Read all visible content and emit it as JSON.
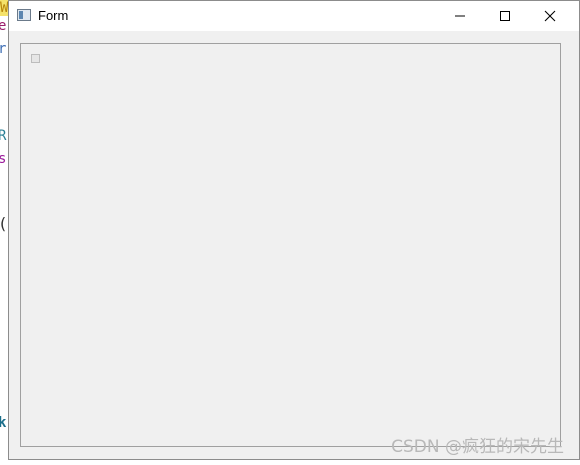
{
  "window": {
    "title": "Form",
    "controls": {
      "minimize": "minimize",
      "maximize": "maximize",
      "close": "close"
    }
  },
  "background_editor": {
    "glyphs": [
      "W",
      "e",
      "r",
      "R",
      "s",
      "(",
      "k"
    ]
  },
  "watermark": {
    "text": "CSDN @疯狂的宋先生"
  },
  "colors": {
    "window_bg": "#f0f0f0",
    "titlebar_bg": "#ffffff",
    "frame_border": "#8c8c8c",
    "groupbox_border": "#a0a0a0"
  }
}
